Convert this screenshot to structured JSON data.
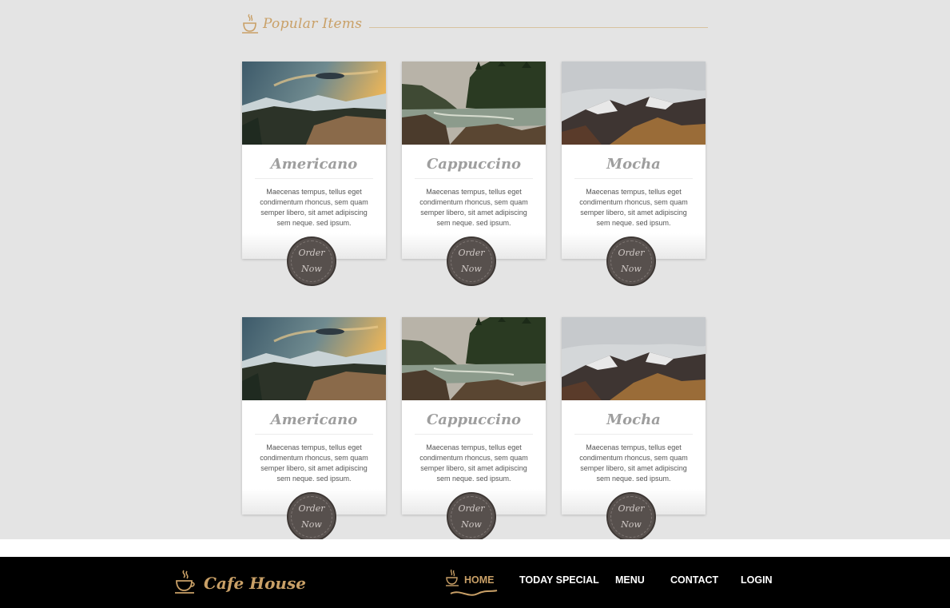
{
  "section": {
    "title": "Popular Items",
    "icon": "coffee-cup-icon",
    "accent": "#c9a067"
  },
  "cards": [
    {
      "title": "Americano",
      "image": "mountain-sunset-photo",
      "description": "Maecenas tempus, tellus eget condimentum rhoncus, sem quam semper libero, sit amet adipiscing sem neque. sed ipsum.",
      "order_line1": "Order",
      "order_line2": "Now"
    },
    {
      "title": "Cappuccino",
      "image": "river-forest-photo",
      "description": "Maecenas tempus, tellus eget condimentum rhoncus, sem quam semper libero, sit amet adipiscing sem neque. sed ipsum.",
      "order_line1": "Order",
      "order_line2": "Now"
    },
    {
      "title": "Mocha",
      "image": "snowy-mountains-photo",
      "description": "Maecenas tempus, tellus eget condimentum rhoncus, sem quam semper libero, sit amet adipiscing sem neque. sed ipsum.",
      "order_line1": "Order",
      "order_line2": "Now"
    },
    {
      "title": "Americano",
      "image": "mountain-sunset-photo",
      "description": "Maecenas tempus, tellus eget condimentum rhoncus, sem quam semper libero, sit amet adipiscing sem neque. sed ipsum.",
      "order_line1": "Order",
      "order_line2": "Now"
    },
    {
      "title": "Cappuccino",
      "image": "river-forest-photo",
      "description": "Maecenas tempus, tellus eget condimentum rhoncus, sem quam semper libero, sit amet adipiscing sem neque. sed ipsum.",
      "order_line1": "Order",
      "order_line2": "Now"
    },
    {
      "title": "Mocha",
      "image": "snowy-mountains-photo",
      "description": "Maecenas tempus, tellus eget condimentum rhoncus, sem quam semper libero, sit amet adipiscing sem neque. sed ipsum.",
      "order_line1": "Order",
      "order_line2": "Now"
    }
  ],
  "navbar": {
    "brand": "Cafe House",
    "brand_icon": "coffee-cup-icon",
    "active_item": "HOME",
    "items": [
      {
        "label": "HOME"
      },
      {
        "label": "TODAY SPECIAL"
      },
      {
        "label": "MENU"
      },
      {
        "label": "CONTACT"
      },
      {
        "label": "LOGIN"
      }
    ]
  }
}
